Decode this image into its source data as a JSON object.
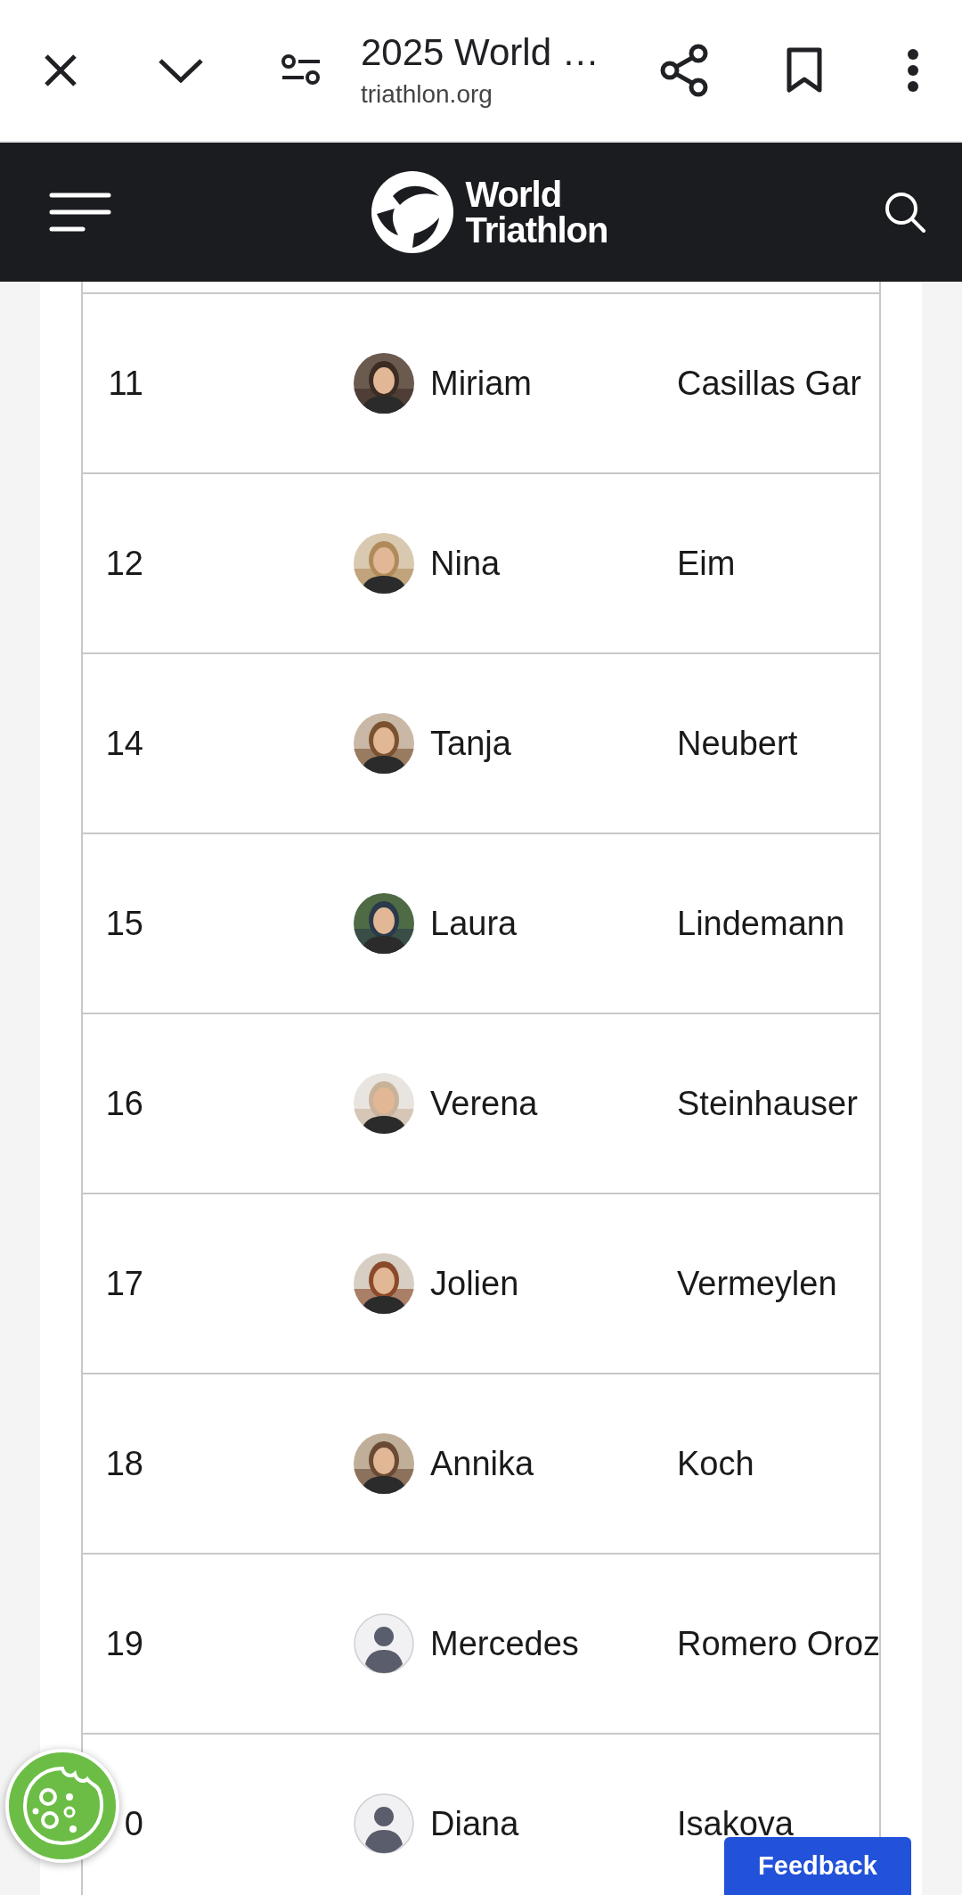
{
  "browser_bar": {
    "title": "2025 World …",
    "url": "triathlon.org"
  },
  "site_header": {
    "logo_text": "World Triathlon"
  },
  "rows": [
    {
      "rank": "11",
      "first_name": "Miriam",
      "last_name": "Casillas Gar",
      "kind": "picture"
    },
    {
      "rank": "12",
      "first_name": "Nina",
      "last_name": "Eim",
      "kind": "picture"
    },
    {
      "rank": "14",
      "first_name": "Tanja",
      "last_name": "Neubert",
      "kind": "picture"
    },
    {
      "rank": "15",
      "first_name": "Laura",
      "last_name": "Lindemann",
      "kind": "picture"
    },
    {
      "rank": "16",
      "first_name": "Verena",
      "last_name": "Steinhauser",
      "kind": "picture"
    },
    {
      "rank": "17",
      "first_name": "Jolien",
      "last_name": "Vermeylen",
      "kind": "picture"
    },
    {
      "rank": "18",
      "first_name": "Annika",
      "last_name": "Koch",
      "kind": "picture"
    },
    {
      "rank": "19",
      "first_name": "Mercedes",
      "last_name": "Romero Oroz",
      "kind": "placeholder"
    },
    {
      "rank": "0",
      "first_name": "Diana",
      "last_name": "Isakova",
      "kind": "placeholder"
    }
  ],
  "feedback_button": "Feedback"
}
